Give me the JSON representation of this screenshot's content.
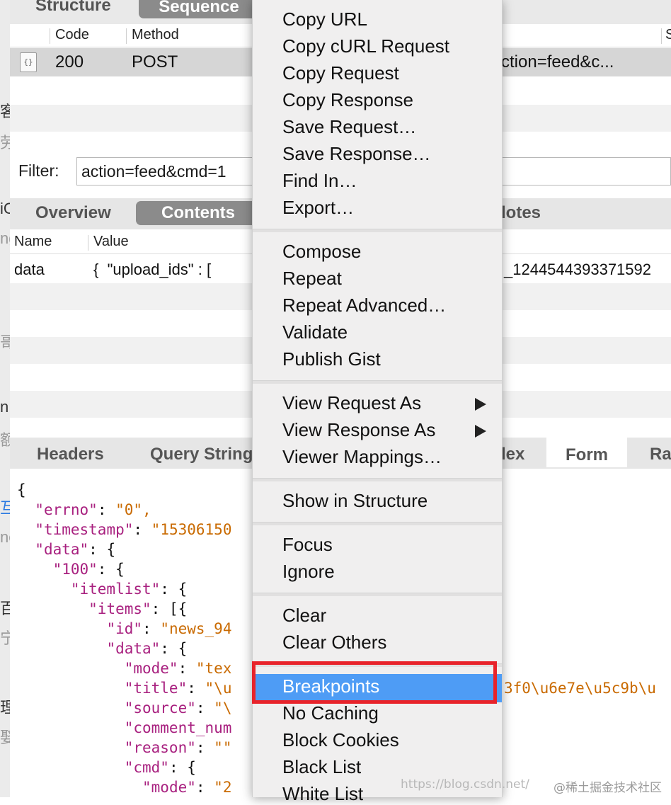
{
  "top_tabs": {
    "structure": "Structure",
    "sequence": "Sequence"
  },
  "table": {
    "headers": {
      "code": "Code",
      "method": "Method",
      "right": "S"
    },
    "row": {
      "icon": "{}",
      "code": "200",
      "method": "POST",
      "tail": "ction=feed&c..."
    }
  },
  "filter": {
    "label": "Filter:",
    "value": "action=feed&cmd=1"
  },
  "mid_tabs": {
    "overview": "Overview",
    "contents": "Contents",
    "notes": "lotes"
  },
  "name_value": {
    "name_header": "Name",
    "value_header": "Value",
    "row_name": "data",
    "row_value": "{  \"upload_ids\" : [",
    "row_tail": "_1244544393371592"
  },
  "bottom_tabs": {
    "headers": "Headers",
    "query": "Query String",
    "hex": "lex",
    "form": "Form",
    "raw": "Ra"
  },
  "json_lines": [
    {
      "indent": "",
      "key": "",
      "sep": "{",
      "val": ""
    },
    {
      "indent": "  ",
      "key": "\"errno\"",
      "sep": ": ",
      "val": "\"0\","
    },
    {
      "indent": "  ",
      "key": "\"timestamp\"",
      "sep": ": ",
      "val": "\"15306150"
    },
    {
      "indent": "  ",
      "key": "\"data\"",
      "sep": ": {",
      "val": ""
    },
    {
      "indent": "    ",
      "key": "\"100\"",
      "sep": ": {",
      "val": ""
    },
    {
      "indent": "      ",
      "key": "\"itemlist\"",
      "sep": ": {",
      "val": ""
    },
    {
      "indent": "        ",
      "key": "\"items\"",
      "sep": ": [{",
      "val": ""
    },
    {
      "indent": "          ",
      "key": "\"id\"",
      "sep": ": ",
      "val": "\"news_94"
    },
    {
      "indent": "          ",
      "key": "\"data\"",
      "sep": ": {",
      "val": ""
    },
    {
      "indent": "            ",
      "key": "\"mode\"",
      "sep": ": ",
      "val": "\"tex"
    },
    {
      "indent": "            ",
      "key": "\"title\"",
      "sep": ": ",
      "val": "\"\\u"
    },
    {
      "indent": "            ",
      "key": "\"source\"",
      "sep": ": ",
      "val": "\"\\"
    },
    {
      "indent": "            ",
      "key": "\"comment_num",
      "sep": "",
      "val": ""
    },
    {
      "indent": "            ",
      "key": "\"reason\"",
      "sep": ": ",
      "val": "\"\""
    },
    {
      "indent": "            ",
      "key": "\"cmd\"",
      "sep": ": {",
      "val": ""
    },
    {
      "indent": "              ",
      "key": "\"mode\"",
      "sep": ": ",
      "val": "\"2"
    }
  ],
  "title_tail": "3f0\\u6e7e\\u5c9b\\u",
  "left_glyphs": [
    "客",
    "劳",
    "iC",
    "ng",
    "哥",
    "n",
    "额",
    "互",
    "ne",
    "百",
    "宁",
    "理",
    "娶"
  ],
  "menu": {
    "group1": [
      "Copy URL",
      "Copy cURL Request",
      "Copy Request",
      "Copy Response",
      "Save Request…",
      "Save Response…",
      "Find In…",
      "Export…"
    ],
    "group2": [
      "Compose",
      "Repeat",
      "Repeat Advanced…",
      "Validate",
      "Publish Gist"
    ],
    "group3": [
      "View Request As",
      "View Response As",
      "Viewer Mappings…"
    ],
    "group4": [
      "Show in Structure"
    ],
    "group5": [
      "Focus",
      "Ignore"
    ],
    "group6": [
      "Clear",
      "Clear Others"
    ],
    "group7": [
      "Breakpoints",
      "No Caching",
      "Block Cookies",
      "Black List",
      "White List"
    ],
    "highlighted": "Breakpoints"
  },
  "watermark": {
    "url": "https://blog.csdn.net/",
    "brand": "@稀土掘金技术社区"
  },
  "colors": {
    "highlight": "#4e9cf5",
    "red_box": "#e8232a",
    "json_key": "#a8207f",
    "json_string": "#c96a00"
  }
}
